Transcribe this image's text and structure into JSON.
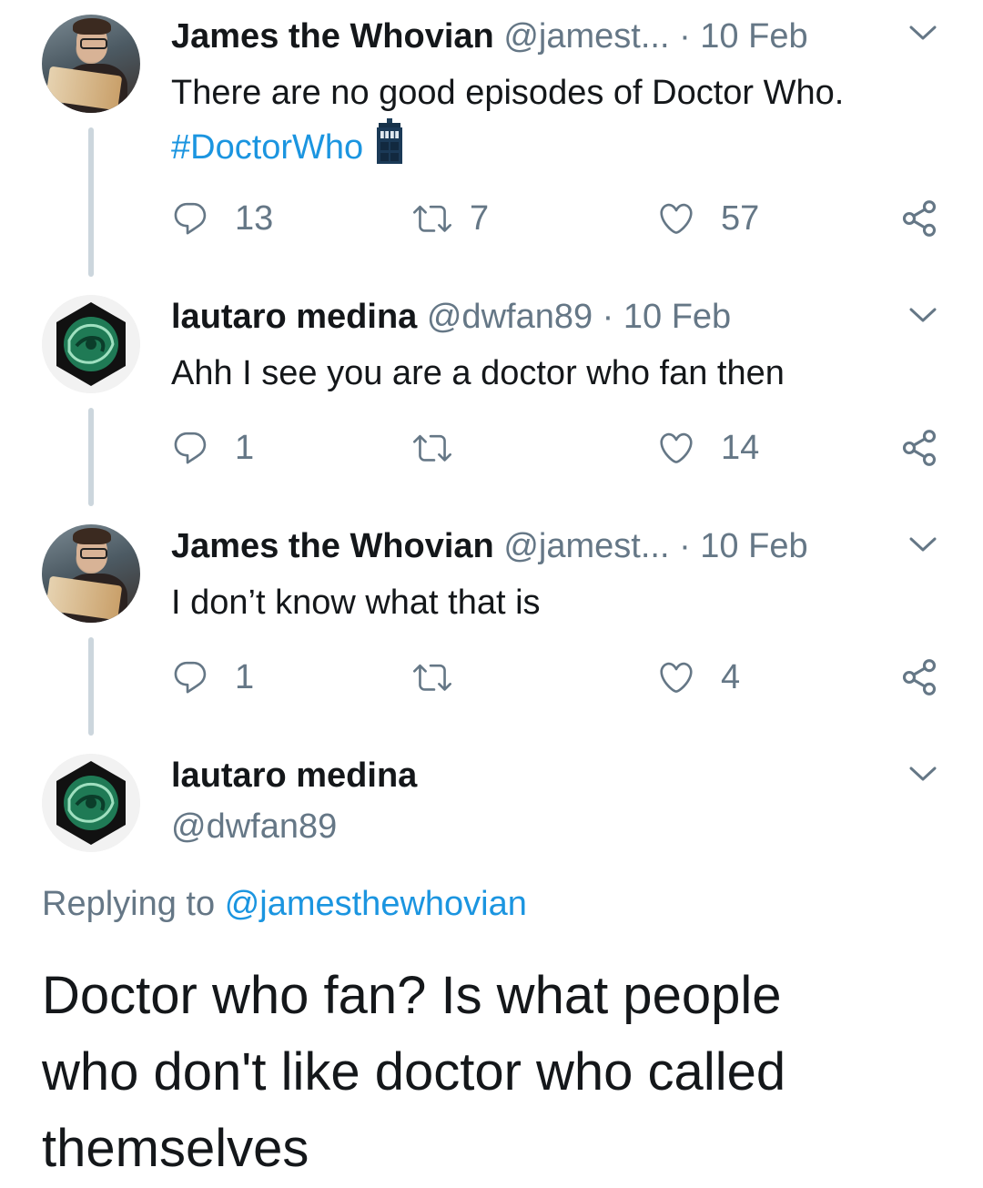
{
  "tweets": [
    {
      "name": "James the Whovian",
      "handle": "@jamest...",
      "dot": "·",
      "date": "10 Feb",
      "text": "There are no good episodes of Doctor Who.",
      "hashtag": "#DoctorWho",
      "reply_count": "13",
      "retweet_count": "7",
      "like_count": "57"
    },
    {
      "name": "lautaro medina",
      "handle": "@dwfan89",
      "dot": "·",
      "date": "10 Feb",
      "text": "Ahh I see you are a doctor who fan then",
      "reply_count": "1",
      "retweet_count": "",
      "like_count": "14"
    },
    {
      "name": "James the Whovian",
      "handle": "@jamest...",
      "dot": "·",
      "date": "10 Feb",
      "text": "I don’t know what that is",
      "reply_count": "1",
      "retweet_count": "",
      "like_count": "4"
    }
  ],
  "main_tweet": {
    "name": "lautaro medina",
    "handle": "@dwfan89",
    "replying_prefix": "Replying to",
    "replying_mention": "@jamesthewhovian",
    "text_lines": [
      "Doctor who fan? Is what people",
      "who don't like doctor who called",
      "themselves"
    ]
  },
  "colors": {
    "link": "#1b95e0",
    "secondary_text": "#657786",
    "thread_line": "#ccd6dd",
    "primary_text": "#14171a"
  },
  "icons": [
    "reply-icon",
    "retweet-icon",
    "like-icon",
    "share-icon",
    "chevron-down-icon",
    "tardis-emoji"
  ]
}
